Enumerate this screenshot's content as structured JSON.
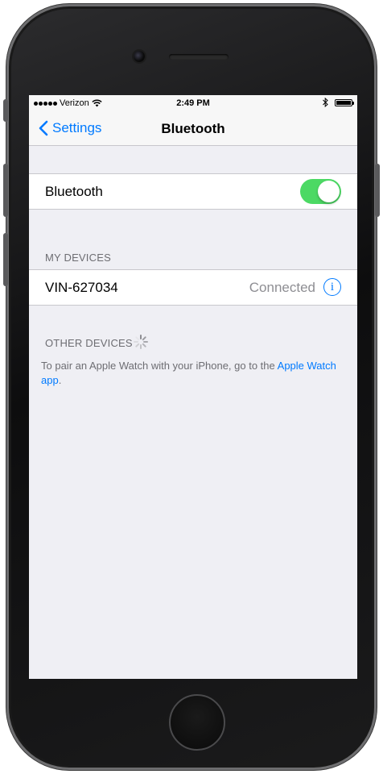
{
  "status_bar": {
    "carrier": "Verizon",
    "time": "2:49 PM",
    "icons": [
      "signal-dots-icon",
      "wifi-icon",
      "bluetooth-icon",
      "battery-icon"
    ]
  },
  "nav": {
    "back_label": "Settings",
    "title": "Bluetooth"
  },
  "bluetooth_row": {
    "label": "Bluetooth",
    "toggle_on": true
  },
  "my_devices": {
    "header": "MY DEVICES",
    "items": [
      {
        "name": "VIN-627034",
        "status": "Connected"
      }
    ]
  },
  "other_devices": {
    "header": "OTHER DEVICES",
    "loading": true
  },
  "footer": {
    "text": "To pair an Apple Watch with your iPhone, go to the ",
    "link": "Apple Watch app",
    "suffix": "."
  },
  "colors": {
    "accent": "#007aff",
    "toggle_on": "#4cd964",
    "background": "#efeff4"
  }
}
